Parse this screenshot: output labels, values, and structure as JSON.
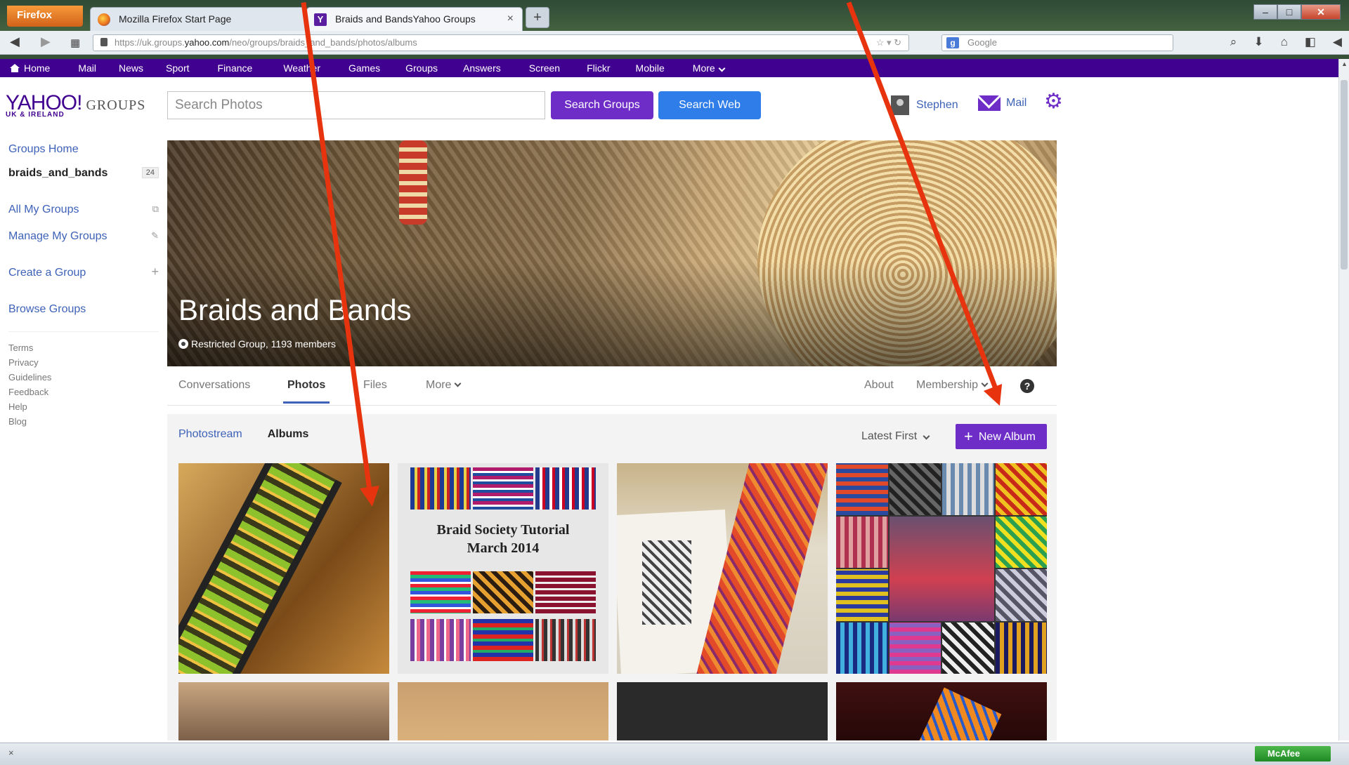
{
  "browser": {
    "menu_button": "Firefox",
    "tabs": [
      {
        "label": "Mozilla Firefox Start Page"
      },
      {
        "label": "Braids and BandsYahoo Groups"
      }
    ],
    "new_tab": "+",
    "url_prefix": "https://uk.groups.",
    "url_domain": "yahoo.com",
    "url_path": "/neo/groups/braids_and_bands/photos/albums",
    "search_placeholder": "Google",
    "status_close": "×",
    "mcafee_label": "McAfee"
  },
  "yahoo_nav": [
    "Home",
    "Mail",
    "News",
    "Sport",
    "Finance",
    "Weather",
    "Games",
    "Groups",
    "Answers",
    "Screen",
    "Flickr",
    "Mobile",
    "More"
  ],
  "header": {
    "logo_main": "YAHOO!",
    "logo_groups": "GROUPS",
    "logo_sub": "UK & IRELAND",
    "search_placeholder": "Search Photos",
    "search_groups_label": "Search Groups",
    "search_web_label": "Search Web",
    "user_name": "Stephen",
    "mail_label": "Mail"
  },
  "sidebar": {
    "groups_home": "Groups Home",
    "current_group": "braids_and_bands",
    "current_group_badge": "24",
    "all_my_groups": "All My Groups",
    "manage_my_groups": "Manage My Groups",
    "create_group": "Create a Group",
    "browse_groups": "Browse Groups",
    "footer_links": [
      "Terms",
      "Privacy",
      "Guidelines",
      "Feedback",
      "Help",
      "Blog"
    ]
  },
  "group": {
    "title": "Braids and Bands",
    "subtitle": "Restricted Group, 1193 members",
    "tabs": [
      "Conversations",
      "Photos",
      "Files",
      "More"
    ],
    "right_tabs": [
      "About",
      "Membership"
    ]
  },
  "photos": {
    "subtabs": [
      "Photostream",
      "Albums"
    ],
    "sort_selected": "Latest First",
    "new_album_label": "New Album",
    "album2_title_line1": "Braid Society Tutorial",
    "album2_title_line2": "March 2014"
  },
  "colors": {
    "yahoo_purple": "#400090",
    "button_purple": "#6f2dc8",
    "button_blue": "#2e7de8",
    "link_blue": "#3e62b8",
    "annotation_arrow": "#e8330f"
  }
}
